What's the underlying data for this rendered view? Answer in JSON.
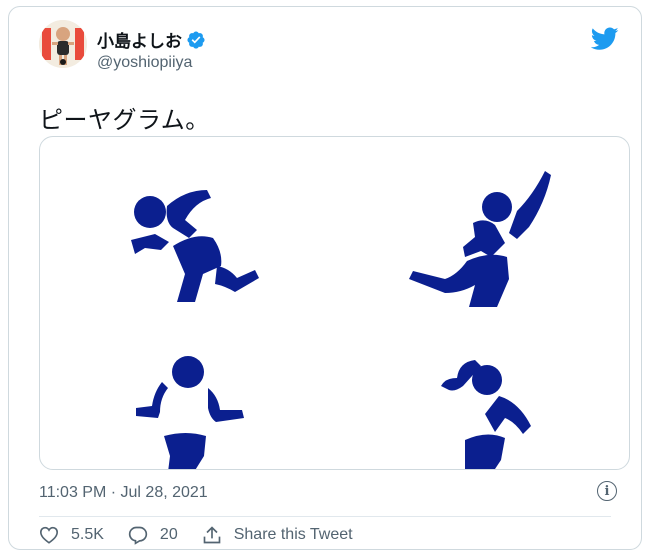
{
  "author": {
    "display_name": "小島よしお",
    "handle": "@yoshiopiiya",
    "verified": true,
    "avatar_text": "小島よしお"
  },
  "tweet": {
    "text": "ピーヤグラム。",
    "timestamp": "11:03 PM · Jul 28, 2021"
  },
  "actions": {
    "likes": "5.5K",
    "replies": "20",
    "share_label": "Share this Tweet"
  },
  "colors": {
    "twitter_blue": "#1d9bf0",
    "pictogram_navy": "#0b1f8f",
    "secondary_text": "#536471"
  },
  "icons": [
    "twitter-bird-icon",
    "verified-badge-icon",
    "info-icon",
    "heart-icon",
    "reply-icon",
    "share-icon"
  ]
}
